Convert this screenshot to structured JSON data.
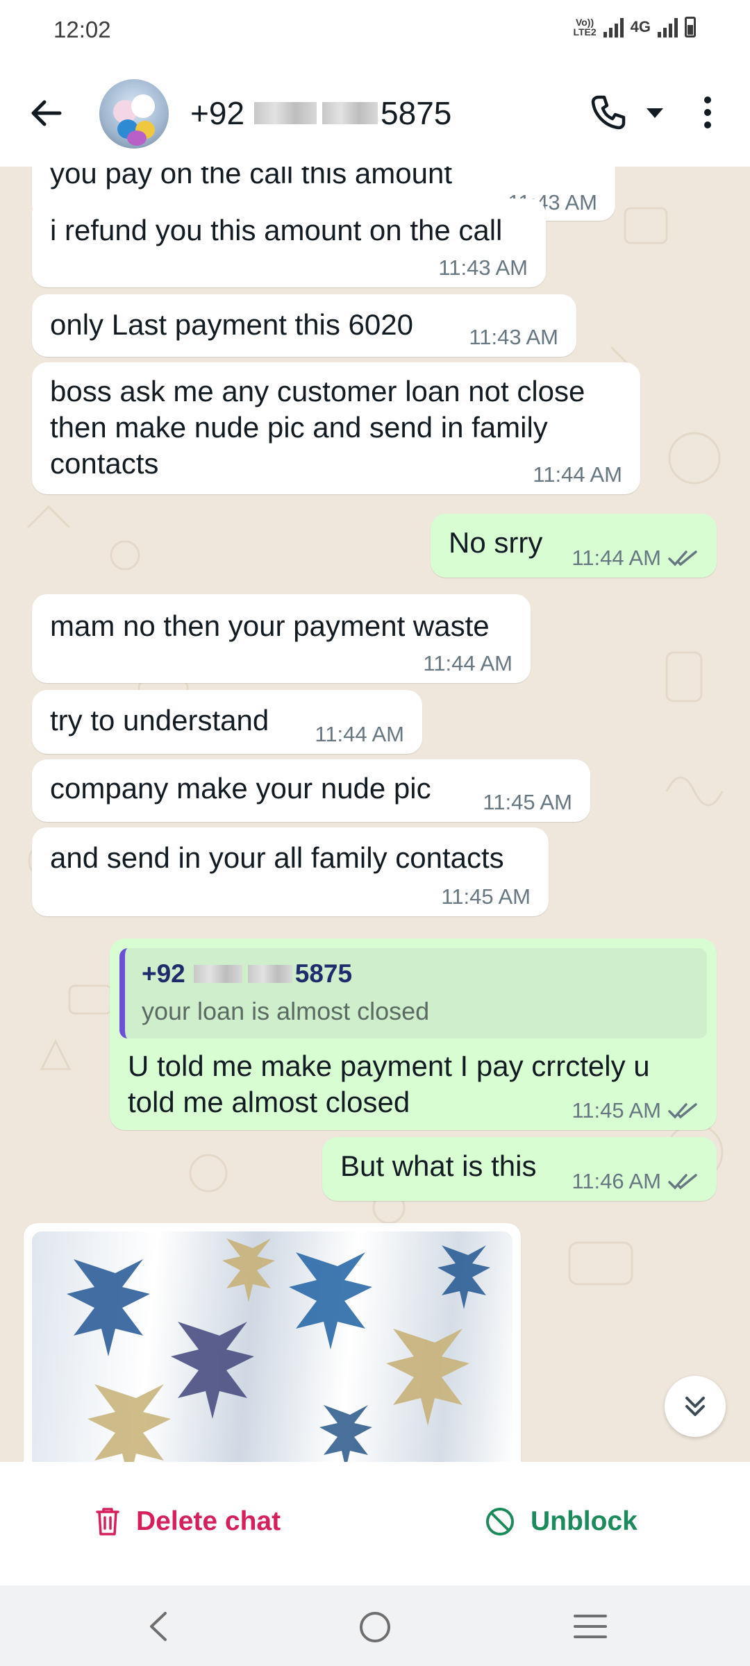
{
  "status_bar": {
    "time": "12:02",
    "volte_line1": "Vo))",
    "volte_line2": "LTE2",
    "network": "4G"
  },
  "header": {
    "contact_prefix": "+92",
    "contact_suffix": "5875",
    "icons": [
      "back-arrow-icon",
      "avatar",
      "call-icon",
      "caret-down-icon",
      "more-vert-icon"
    ]
  },
  "messages": [
    {
      "dir": "in",
      "text": "you pay on the call this amount",
      "time": "11:43 AM"
    },
    {
      "dir": "in",
      "text": "i refund you this amount on the call",
      "time": "11:43 AM"
    },
    {
      "dir": "in",
      "text": "only Last payment this 6020",
      "time": "11:43 AM"
    },
    {
      "dir": "in",
      "text_lines": [
        "boss ask me any customer loan not close",
        "then make nude pic and send in family",
        "contacts"
      ],
      "time": "11:44 AM"
    },
    {
      "dir": "out",
      "text": "No srry",
      "time": "11:44 AM"
    },
    {
      "dir": "in",
      "text": "mam no then your payment waste",
      "time": "11:44 AM"
    },
    {
      "dir": "in",
      "text": "try to understand",
      "time": "11:44 AM"
    },
    {
      "dir": "in",
      "text": "company make your nude pic",
      "time": "11:45 AM"
    },
    {
      "dir": "in",
      "text": "and send in your all family contacts",
      "time": "11:45 AM"
    },
    {
      "dir": "out",
      "reply_name_prefix": "+92",
      "reply_name_suffix": "5875",
      "reply_text": "your loan is almost closed",
      "text_lines": [
        "U told me make payment I pay crrctely u",
        "told me almost closed"
      ],
      "time": "11:45 AM"
    },
    {
      "dir": "out",
      "text": "But what is this",
      "time": "11:46 AM"
    }
  ],
  "actions": {
    "delete_label": "Delete chat",
    "unblock_label": "Unblock"
  },
  "colors": {
    "incoming_bubble": "#ffffff",
    "outgoing_bubble": "#d9fdd3",
    "chat_background": "#efe7dc",
    "delete": "#d6205c",
    "unblock": "#1c8a5b",
    "read_ticks": "#667781"
  }
}
